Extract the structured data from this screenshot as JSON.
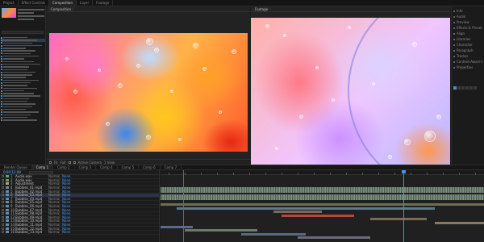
{
  "window": {
    "tabs": [
      "Project",
      "Effect Controls",
      "Composition",
      "Layer",
      "Footage"
    ],
    "active_tab_index": 2
  },
  "project": {
    "item_count": 32,
    "selected_index": 1
  },
  "viewer": {
    "tab_label": "Composition",
    "zoom": "Fit",
    "footer_labels": [
      "Fit",
      "Full",
      "Active Camera",
      "1 View"
    ]
  },
  "footage": {
    "tab_label": "Footage"
  },
  "right_panel": {
    "items": [
      "Info",
      "Audio",
      "Preview",
      "Effects & Presets",
      "Align",
      "Libraries",
      "Character",
      "Paragraph",
      "Tracker",
      "Content-Aware Fill",
      "Properties"
    ]
  },
  "timeline": {
    "tabs": [
      "Render Queue",
      "Comp 1",
      "Comp 2",
      "Comp 3",
      "Comp 4",
      "Comp 5",
      "Comp 6",
      "Comp 7"
    ],
    "active_tab_index": 1,
    "timecode": "0:00:12:08",
    "layers": [
      {
        "num": "1",
        "name": "Audio.wav",
        "mode": "Normal",
        "parent": "None",
        "color": "#6a9a6a"
      },
      {
        "num": "2",
        "name": "Audio.wav",
        "mode": "Normal",
        "parent": "None",
        "color": "#6a9a6a"
      },
      {
        "num": "3",
        "name": "Adjustment",
        "mode": "Normal",
        "parent": "None",
        "color": "#b8a070"
      },
      {
        "num": "4",
        "name": "Bubbles_01.mp4",
        "mode": "Normal",
        "parent": "None",
        "color": "#5e8fb0"
      },
      {
        "num": "5",
        "name": "Bubbles_02.mp4",
        "mode": "Normal",
        "parent": "None",
        "color": "#5e8fb0"
      },
      {
        "num": "6",
        "name": "Bubbles_03.mp4",
        "mode": "Normal",
        "parent": "None",
        "color": "#5e8fb0"
      },
      {
        "num": "7",
        "name": "Bubbles_04.mp4",
        "mode": "Normal",
        "parent": "None",
        "color": "#5e8fb0"
      },
      {
        "num": "8",
        "name": "Bubbles_05.mp4",
        "mode": "Normal",
        "parent": "None",
        "color": "#5e8fb0"
      },
      {
        "num": "9",
        "name": "Bubbles_06.mp4",
        "mode": "Normal",
        "parent": "None",
        "color": "#5e8fb0"
      },
      {
        "num": "10",
        "name": "Bubbles_07.mp4",
        "mode": "Normal",
        "parent": "None",
        "color": "#5e8fb0"
      },
      {
        "num": "11",
        "name": "Bubbles_08.mp4",
        "mode": "Normal",
        "parent": "None",
        "color": "#5e8fb0"
      },
      {
        "num": "12",
        "name": "Bubbles_09.mp4",
        "mode": "Normal",
        "parent": "None",
        "color": "#5e8fb0"
      },
      {
        "num": "13",
        "name": "Bubbles_10.mp4",
        "mode": "Normal",
        "parent": "None",
        "color": "#5e8fb0"
      },
      {
        "num": "14",
        "name": "Bubbles_11.mp4",
        "mode": "Normal",
        "parent": "None",
        "color": "#5e8fb0"
      },
      {
        "num": "15",
        "name": "Bubbles_12.mp4",
        "mode": "Normal",
        "parent": "None",
        "color": "#5e8fb0"
      },
      {
        "num": "16",
        "name": "Bubbles_13.mp4",
        "mode": "Normal",
        "parent": "None",
        "color": "#5e8fb0"
      }
    ],
    "selected_layer_index": 5,
    "playhead_position": "0:00:12:08"
  },
  "colors": {
    "accent": "#4a8fe0",
    "panel_bg": "#1d1d1d",
    "selection": "#2c3e57"
  }
}
